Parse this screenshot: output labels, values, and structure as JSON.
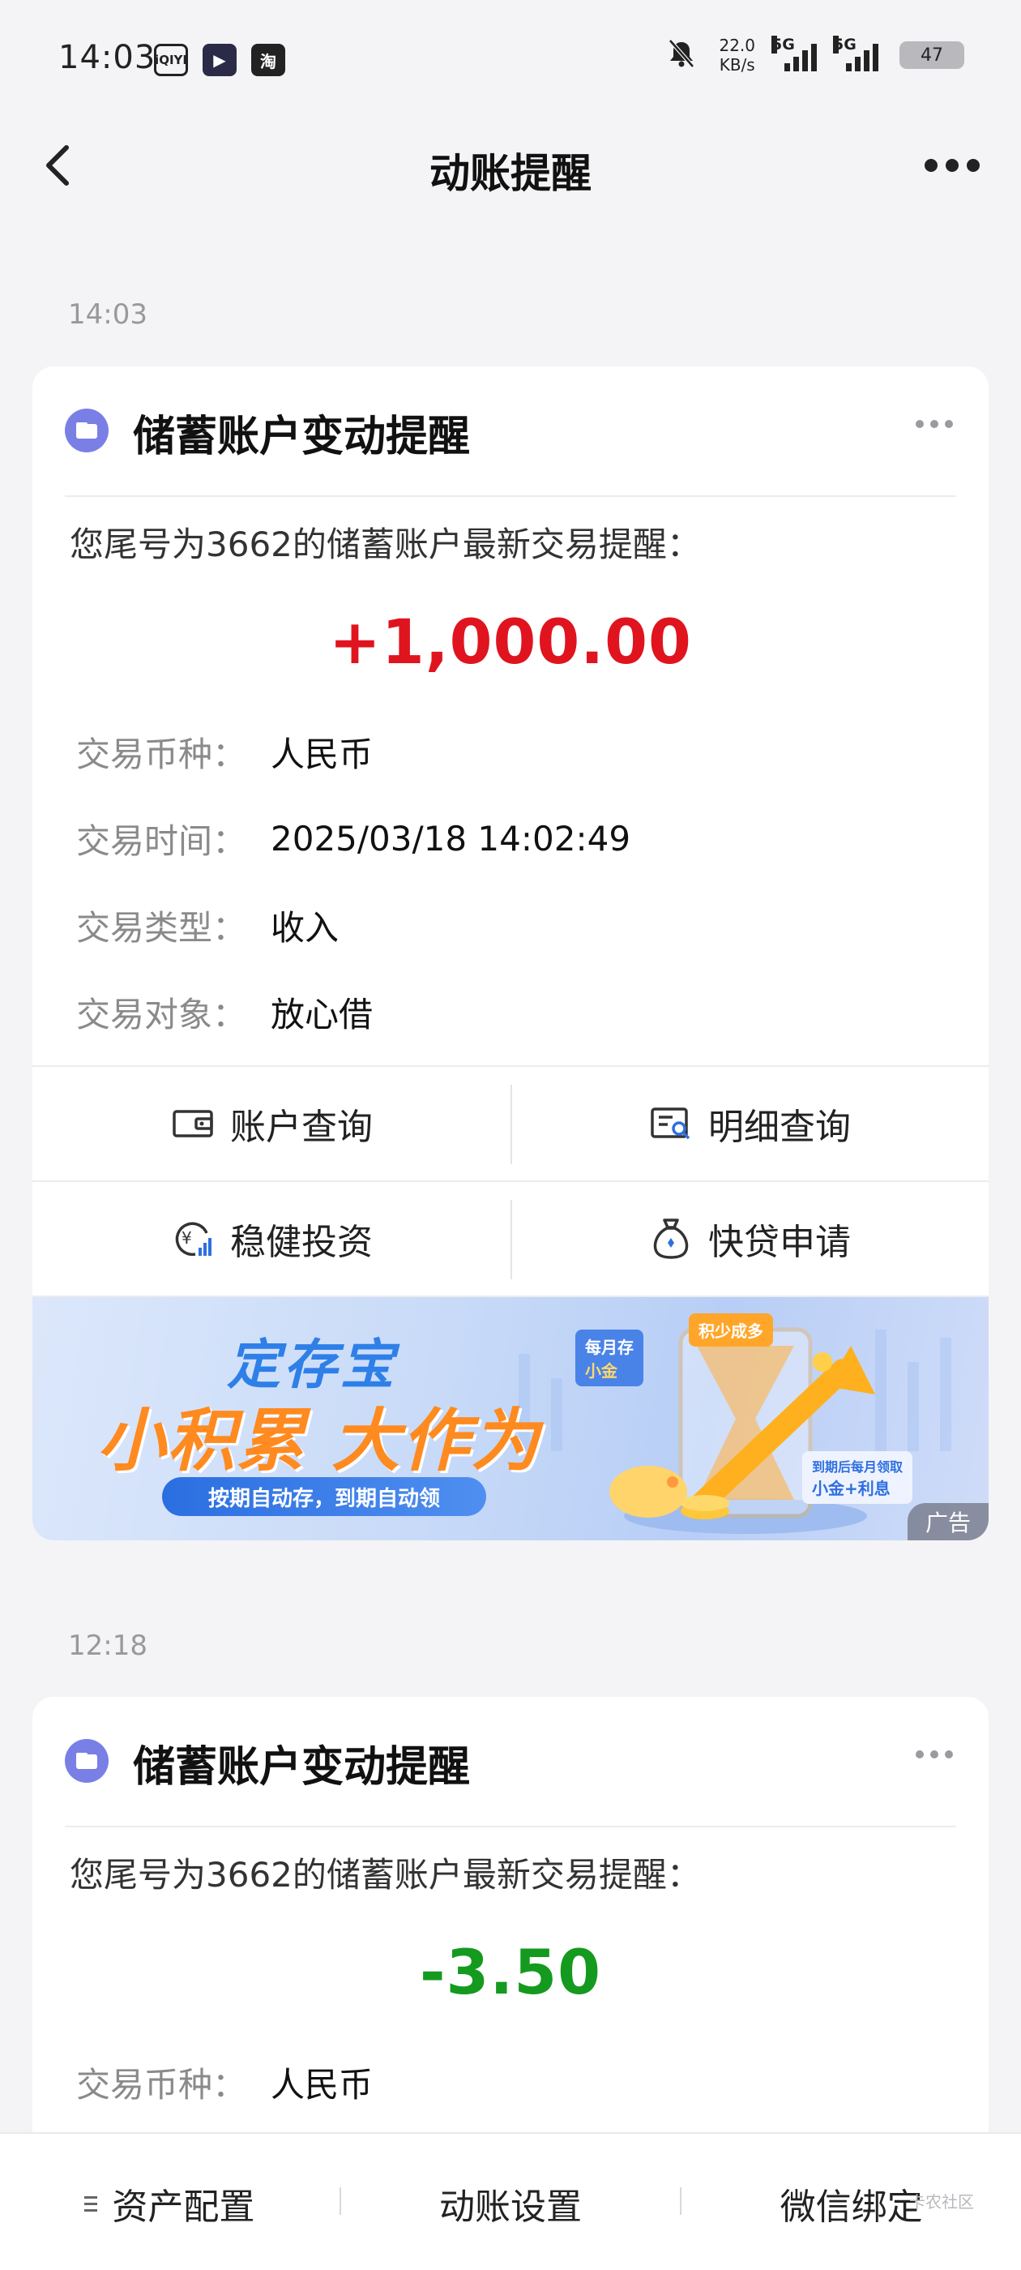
{
  "status_bar": {
    "time": "14:03",
    "apps": [
      "iQIYI",
      "▶",
      "淘"
    ],
    "net_speed": "22.0",
    "net_unit": "KB/s",
    "signal1": "5G",
    "signal2": "5G",
    "battery": "47"
  },
  "nav": {
    "title": "动账提醒"
  },
  "messages": [
    {
      "time": "14:03",
      "title": "储蓄账户变动提醒",
      "intro": "您尾号为3662的储蓄账户最新交易提醒：",
      "amount": "+1,000.00",
      "rows": [
        {
          "k": "交易币种：",
          "v": "人民币"
        },
        {
          "k": "交易时间：",
          "v": "2025/03/18 14:02:49"
        },
        {
          "k": "交易类型：",
          "v": "收入"
        },
        {
          "k": "交易对象：",
          "v": "放心借"
        }
      ],
      "actions": [
        "账户查询",
        "明细查询",
        "稳健投资",
        "快贷申请"
      ]
    },
    {
      "time": "12:18",
      "title": "储蓄账户变动提醒",
      "intro": "您尾号为3662的储蓄账户最新交易提醒：",
      "amount": "-3.50",
      "rows": [
        {
          "k": "交易币种：",
          "v": "人民币"
        }
      ]
    }
  ],
  "banner": {
    "line1": "定存宝",
    "line2": "小积累 大作为",
    "line3": "按期自动存，到期自动领",
    "tag1": "每月存",
    "tag1b": "小金",
    "tag2": "积少成多",
    "tag3": "到期后每月领取",
    "tag3b": "小金+利息",
    "ad": "广告"
  },
  "bottom_bar": [
    "资产配置",
    "动账设置",
    "微信绑定"
  ],
  "watermark": "卡农社区",
  "colors": {
    "positive": "#e0141e",
    "negative": "#149a1e",
    "accent": "#7a7fe6"
  }
}
